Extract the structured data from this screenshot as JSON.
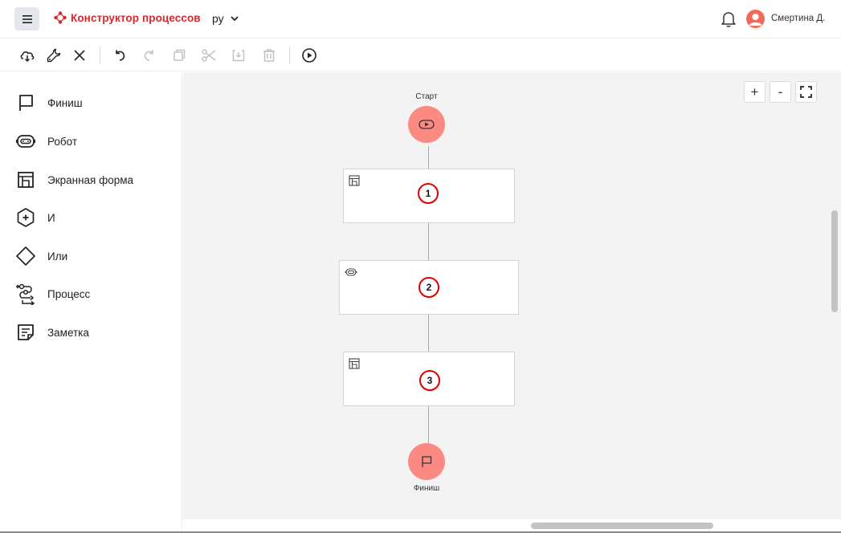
{
  "header": {
    "app_title": "Конструктор процессов",
    "language": "ру",
    "user_name": "Смертина Д."
  },
  "toolbar": {
    "items": [
      "cloud-save-icon",
      "settings-wrench-icon",
      "close-icon",
      "undo-icon",
      "redo-icon",
      "copy-icon",
      "cut-icon",
      "paste-icon",
      "delete-icon",
      "play-icon"
    ]
  },
  "sidebar": {
    "items": [
      {
        "label": "Финиш",
        "icon": "flag-icon"
      },
      {
        "label": "Робот",
        "icon": "robot-icon"
      },
      {
        "label": "Экранная форма",
        "icon": "screen-form-icon"
      },
      {
        "label": "И",
        "icon": "and-gateway-icon"
      },
      {
        "label": "Или",
        "icon": "or-gateway-icon"
      },
      {
        "label": "Процесс",
        "icon": "process-icon"
      },
      {
        "label": "Заметка",
        "icon": "note-icon"
      }
    ]
  },
  "canvas": {
    "zoom_in": "+",
    "zoom_out": "-",
    "start_label": "Старт",
    "finish_label": "Финиш",
    "tasks": [
      {
        "badge": "1",
        "icon": "screen-form-icon"
      },
      {
        "badge": "2",
        "icon": "robot-icon"
      },
      {
        "badge": "3",
        "icon": "screen-form-icon"
      }
    ]
  },
  "colors": {
    "brand": "#d9262c",
    "node_fill": "#fb8a82",
    "badge_border": "#e00000",
    "canvas_bg": "#f3f3f3"
  }
}
